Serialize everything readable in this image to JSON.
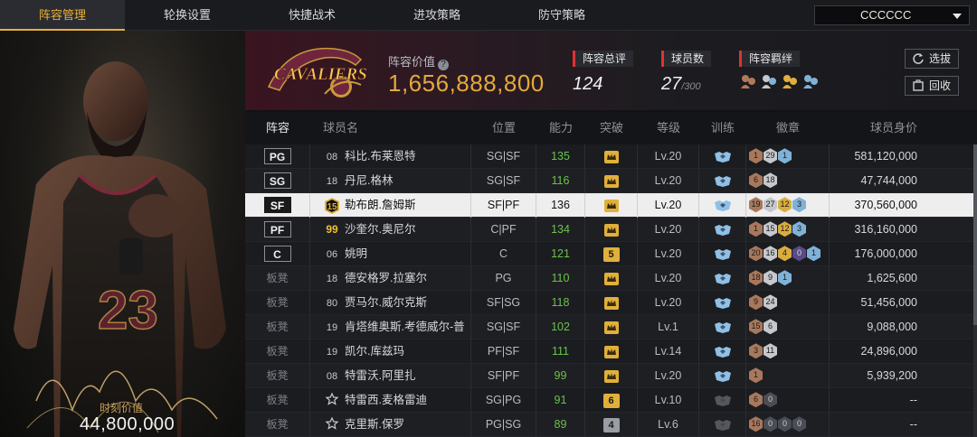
{
  "nav": {
    "tabs": [
      "阵容管理",
      "轮换设置",
      "快捷战术",
      "进攻策略",
      "防守策略"
    ],
    "active": 0,
    "dropdown_value": "CCCCCC"
  },
  "portrait": {
    "jersey": "23",
    "market_value_label": "时刻价值",
    "market_value": "44,800,000"
  },
  "header": {
    "team_logo_text": "CAVALIERS",
    "value_label": "阵容价值",
    "help_icon": "?",
    "value": "1,656,888,800",
    "rating_label": "阵容总评",
    "rating": "124",
    "players_label": "球员数",
    "players": "27",
    "players_max": "/300",
    "bonds_label": "阵容羁绊",
    "select_button": "选拔",
    "recycle_button": "回收"
  },
  "table": {
    "headers": [
      "阵容",
      "球员名",
      "位置",
      "能力",
      "突破",
      "等级",
      "训练",
      "徽章",
      "球员身价"
    ],
    "rows": [
      {
        "pos": "PG",
        "starter": true,
        "num": "08",
        "num_style": "plain",
        "name": "科比.布莱恩特",
        "role": "SG|SF",
        "ability": "135",
        "ab_green": true,
        "breakthrough": "crown",
        "level": "Lv.20",
        "train": "blue",
        "badges": [
          [
            "bronze",
            "1"
          ],
          [
            "silver",
            "29"
          ],
          [
            "blue",
            "1"
          ]
        ],
        "price": "581,120,000"
      },
      {
        "pos": "SG",
        "starter": true,
        "num": "18",
        "num_style": "plain",
        "name": "丹尼.格林",
        "role": "SG|SF",
        "ability": "116",
        "ab_green": true,
        "breakthrough": "crown",
        "level": "Lv.20",
        "train": "blue",
        "badges": [
          [
            "bronze",
            "6"
          ],
          [
            "silver",
            "18"
          ]
        ],
        "price": "47,744,000"
      },
      {
        "pos": "SF",
        "starter": true,
        "num": "15",
        "num_style": "badge",
        "name": "勒布朗.詹姆斯",
        "role": "SF|PF",
        "ability": "136",
        "ab_green": false,
        "breakthrough": "crown",
        "level": "Lv.20",
        "train": "blue",
        "badges": [
          [
            "bronze",
            "19"
          ],
          [
            "silver",
            "27"
          ],
          [
            "gold",
            "12"
          ],
          [
            "blue",
            "3"
          ]
        ],
        "price": "370,560,000",
        "selected": true
      },
      {
        "pos": "PF",
        "starter": true,
        "num": "99",
        "num_style": "gold",
        "name": "沙奎尔.奥尼尔",
        "role": "C|PF",
        "ability": "134",
        "ab_green": true,
        "breakthrough": "crown",
        "level": "Lv.20",
        "train": "blue",
        "badges": [
          [
            "bronze",
            "1"
          ],
          [
            "silver",
            "15"
          ],
          [
            "gold",
            "12"
          ],
          [
            "blue",
            "3"
          ]
        ],
        "price": "316,160,000"
      },
      {
        "pos": "C",
        "starter": true,
        "num": "06",
        "num_style": "plain",
        "name": "姚明",
        "role": "C",
        "ability": "121",
        "ab_green": true,
        "breakthrough": "5",
        "level": "Lv.20",
        "train": "blue",
        "badges": [
          [
            "bronze",
            "20"
          ],
          [
            "silver",
            "16"
          ],
          [
            "gold",
            "4"
          ],
          [
            "purple",
            "0"
          ],
          [
            "blue",
            "1"
          ]
        ],
        "price": "176,000,000"
      },
      {
        "pos": "板凳",
        "starter": false,
        "num": "18",
        "num_style": "plain",
        "name": "德安格罗.拉塞尔",
        "role": "PG",
        "ability": "110",
        "ab_green": true,
        "breakthrough": "crown",
        "level": "Lv.20",
        "train": "blue",
        "badges": [
          [
            "bronze",
            "18"
          ],
          [
            "silver",
            "9"
          ],
          [
            "blue",
            "1"
          ]
        ],
        "price": "1,625,600"
      },
      {
        "pos": "板凳",
        "starter": false,
        "num": "80",
        "num_style": "plain",
        "name": "贾马尔.威尔克斯",
        "role": "SF|SG",
        "ability": "118",
        "ab_green": true,
        "breakthrough": "crown",
        "level": "Lv.20",
        "train": "blue",
        "badges": [
          [
            "bronze",
            "9"
          ],
          [
            "silver",
            "24"
          ]
        ],
        "price": "51,456,000"
      },
      {
        "pos": "板凳",
        "starter": false,
        "num": "19",
        "num_style": "plain",
        "name": "肯塔维奥斯.考德威尔-普博",
        "role": "SG|SF",
        "ability": "102",
        "ab_green": true,
        "breakthrough": "crown",
        "level": "Lv.1",
        "train": "blue",
        "badges": [
          [
            "bronze",
            "15"
          ],
          [
            "silver",
            "6"
          ]
        ],
        "price": "9,088,000"
      },
      {
        "pos": "板凳",
        "starter": false,
        "num": "19",
        "num_style": "plain",
        "name": "凯尔.库兹玛",
        "role": "PF|SF",
        "ability": "111",
        "ab_green": true,
        "breakthrough": "crown",
        "level": "Lv.14",
        "train": "blue",
        "badges": [
          [
            "bronze",
            "3"
          ],
          [
            "silver",
            "11"
          ]
        ],
        "price": "24,896,000"
      },
      {
        "pos": "板凳",
        "starter": false,
        "num": "08",
        "num_style": "plain",
        "name": "特雷沃.阿里扎",
        "role": "SF|PF",
        "ability": "99",
        "ab_green": true,
        "breakthrough": "crown",
        "level": "Lv.20",
        "train": "blue",
        "badges": [
          [
            "bronze",
            "1"
          ]
        ],
        "price": "5,939,200"
      },
      {
        "pos": "板凳",
        "starter": false,
        "num": "★",
        "num_style": "star",
        "name": "特雷西.麦格雷迪",
        "role": "SG|PG",
        "ability": "91",
        "ab_green": true,
        "breakthrough": "6",
        "level": "Lv.10",
        "train": "grey",
        "badges": [
          [
            "bronze",
            "6"
          ],
          [
            "dark",
            "0"
          ]
        ],
        "price": "--"
      },
      {
        "pos": "板凳",
        "starter": false,
        "num": "★",
        "num_style": "star",
        "name": "克里斯.保罗",
        "role": "PG|SG",
        "ability": "89",
        "ab_green": true,
        "breakthrough": "4",
        "level": "Lv.6",
        "train": "grey",
        "badges": [
          [
            "bronze",
            "16"
          ],
          [
            "dark",
            "0"
          ],
          [
            "dark",
            "0"
          ],
          [
            "dark",
            "0"
          ]
        ],
        "price": "--"
      }
    ]
  },
  "colors": {
    "accent": "#e8b038",
    "value_gold": "#e4a93a",
    "ability_green": "#6ac24b",
    "team_wine": "#6f263d"
  }
}
